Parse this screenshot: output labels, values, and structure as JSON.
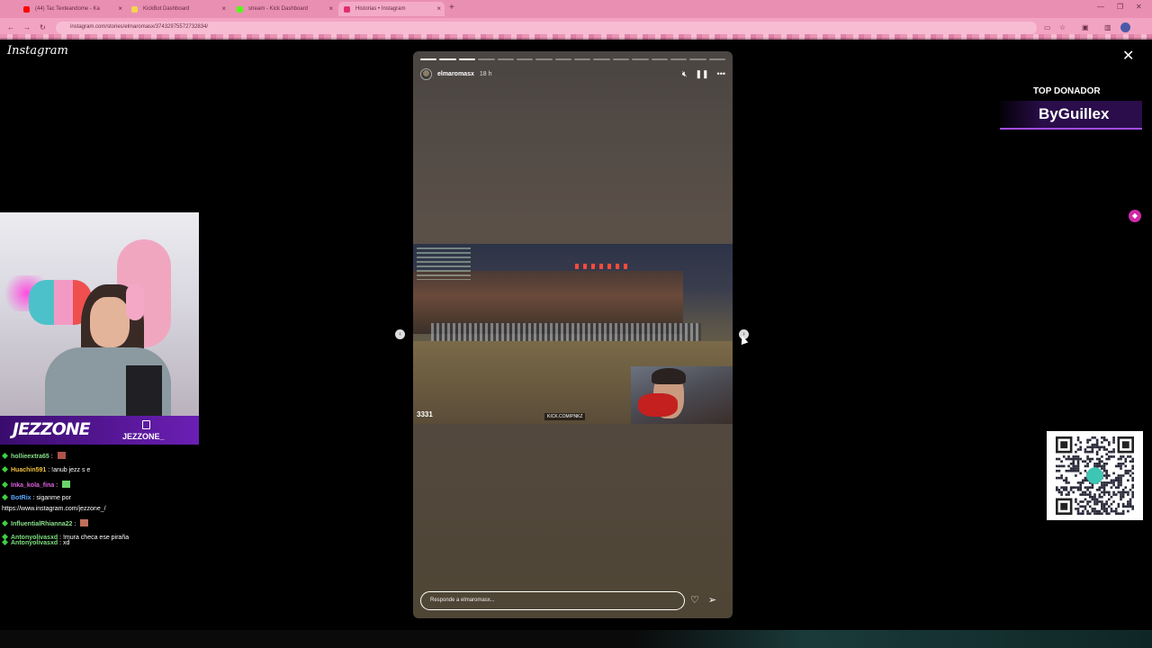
{
  "browser": {
    "tabs": [
      {
        "label": "(44) Tac Texteandome - Ka",
        "fav_color": "#ff0000"
      },
      {
        "label": "KickBot Dashboard",
        "fav_color": "#f4d44c"
      },
      {
        "label": "stream - Kick Dashboard",
        "fav_color": "#53fc18"
      },
      {
        "label": "Historias • Instagram",
        "fav_color": "#e1306c"
      }
    ],
    "new_tab": "+",
    "url": "instagram.com/stories/elmaromasx/3743297557273283​4/"
  },
  "instagram": {
    "logo": "Instagram",
    "close": "✕"
  },
  "story": {
    "username": "elmaromasx",
    "time_ago": "18 h",
    "progress_done": 3,
    "progress_total": 16,
    "media_tag": "KICK.COM/PNKZ",
    "media_number": "3331",
    "reply_placeholder": "Responde a elmaromasx...",
    "prev": "‹",
    "next": "›"
  },
  "overlay": {
    "top_donador_title": "TOP DONADOR",
    "top_donador_name": "ByGuillex",
    "brand_left": "JEZZONE",
    "brand_right": "JEZZONE_"
  },
  "chat": [
    {
      "nick": "hollieextra65",
      "msg": " : ",
      "nick_color": "#8be08b",
      "emote": "#b0524a"
    },
    {
      "nick": "Huachin591",
      "msg": " : !anub jezz s e",
      "nick_color": "#f0c040",
      "emote": ""
    },
    {
      "nick": "Inka_kola_fina",
      "msg": " : ",
      "nick_color": "#e060e0",
      "emote": "#6bd36b"
    },
    {
      "nick": "BotRix",
      "msg": " : siganme por",
      "nick_color": "#5aa9ff",
      "emote": ""
    },
    {
      "nick": "",
      "msg": "https://www.instagram.com/jezzone_/",
      "nick_color": "#ffffff",
      "emote": ""
    },
    {
      "nick": "InfluentialRhianna22",
      "msg": " : ",
      "nick_color": "#8be08b",
      "emote": "#c06f5a"
    },
    {
      "nick": "Antonyolivasxd",
      "msg": " : !mura checa ese piraña",
      "nick_color": "#7fe07f",
      "emote": ""
    },
    {
      "nick": "Antonyolivasxd",
      "msg": " : xd",
      "nick_color": "#7fe07f",
      "emote": ""
    }
  ],
  "colors": {
    "browser_chrome": "#e98fb2",
    "donador_accent": "#a34df2",
    "kick_green": "#53fc18"
  }
}
